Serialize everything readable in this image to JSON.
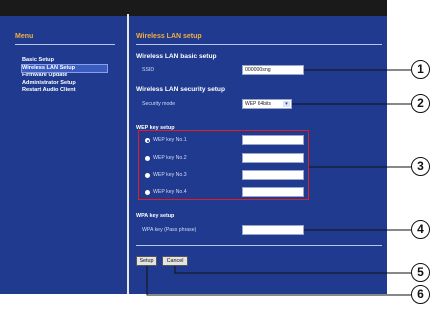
{
  "sidebar": {
    "title": "Menu",
    "items": [
      {
        "label": "Basic Setup",
        "active": false
      },
      {
        "label": "Wireless LAN Setup",
        "active": true
      },
      {
        "label": "Firmware Update",
        "active": false
      },
      {
        "label": "Administrator Setup",
        "active": false
      },
      {
        "label": "Restart Audio Client",
        "active": false
      }
    ]
  },
  "main": {
    "title": "Wireless LAN setup",
    "basic": {
      "heading": "Wireless LAN basic setup",
      "ssid_label": "SSID",
      "ssid_value": "000000sng"
    },
    "security": {
      "heading": "Wireless LAN security setup",
      "mode_label": "Security mode",
      "mode_value": "WEP 64bits"
    },
    "wep": {
      "heading": "WEP key setup",
      "keys": [
        {
          "label": "WEP key No.1",
          "selected": true,
          "value": ""
        },
        {
          "label": "WEP key No.2",
          "selected": false,
          "value": ""
        },
        {
          "label": "WEP key No.3",
          "selected": false,
          "value": ""
        },
        {
          "label": "WEP key No.4",
          "selected": false,
          "value": ""
        }
      ]
    },
    "wpa": {
      "heading": "WPA key setup",
      "label": "WPA key (Pass phrase)",
      "value": ""
    },
    "buttons": {
      "setup": "Setup",
      "cancel": "Cancel"
    }
  },
  "callouts": [
    "1",
    "2",
    "3",
    "4",
    "5",
    "6"
  ],
  "colors": {
    "frame": "#1f3a8f",
    "accent": "#f0b040",
    "highlight": "#e02020"
  }
}
